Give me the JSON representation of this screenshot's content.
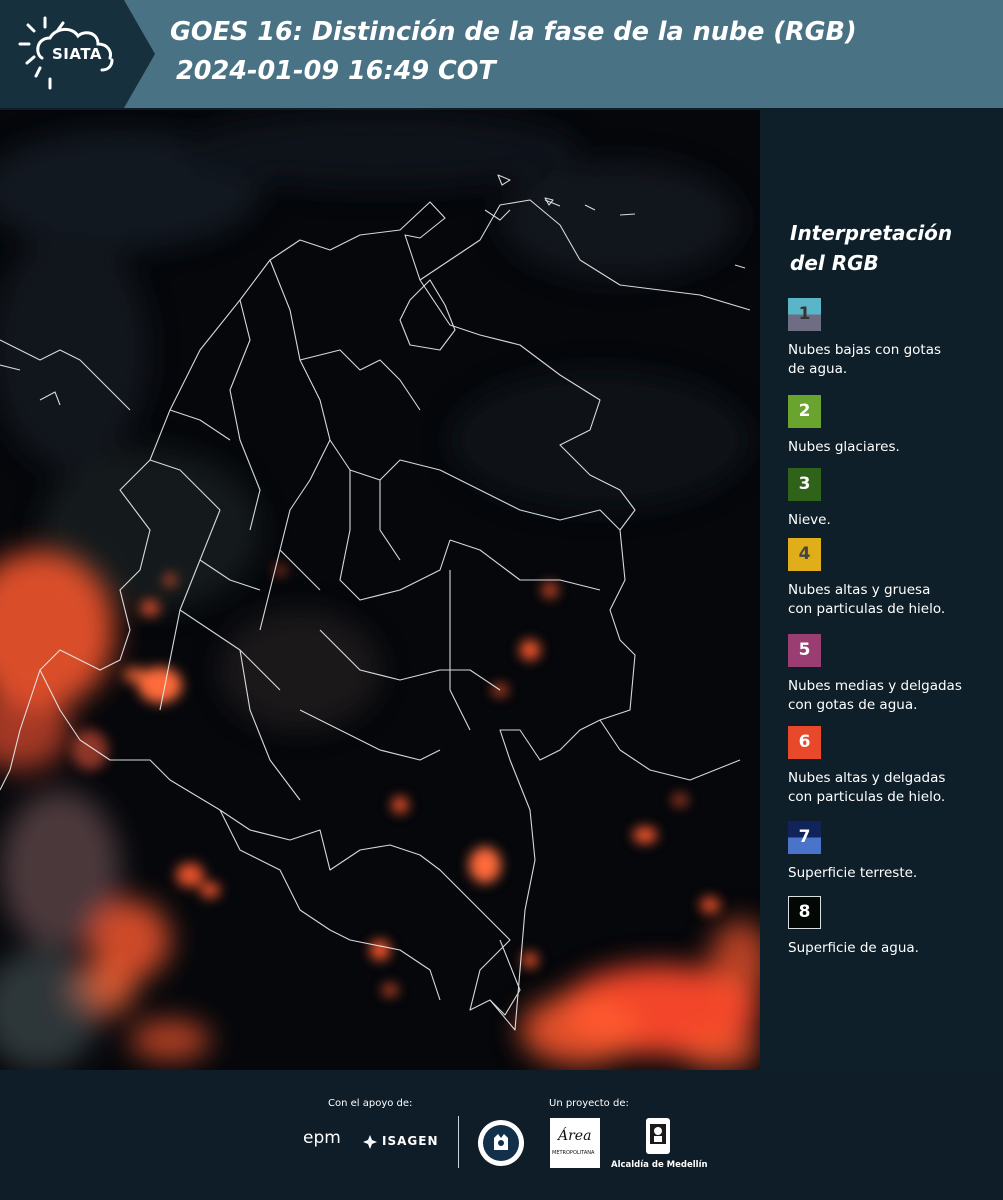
{
  "header": {
    "logo_text": "SIATA",
    "title_line1": "GOES 16: Distinción de la fase de la nube (RGB)",
    "title_line2": "2024-01-09 16:49 COT"
  },
  "legend": {
    "title_line1": "Interpretación",
    "title_line2": "del RGB",
    "items": [
      {
        "number": "1",
        "label_lines": [
          "Nubes bajas con gotas",
          "de agua."
        ],
        "color_top": "#5ab5c8",
        "color_bottom": "#6e6d84",
        "text_color": "#333333"
      },
      {
        "number": "2",
        "label_lines": [
          "Nubes glaciares."
        ],
        "color_top": "#6aa32e",
        "color_bottom": "#6aa32e",
        "text_color": "#ffffff"
      },
      {
        "number": "3",
        "label_lines": [
          "Nieve."
        ],
        "color_top": "#2f6319",
        "color_bottom": "#2f6319",
        "text_color": "#ffffff"
      },
      {
        "number": "4",
        "label_lines": [
          "Nubes altas y gruesa",
          "con particulas de hielo."
        ],
        "color_top": "#e0ae1a",
        "color_bottom": "#e0ae1a",
        "text_color": "#444444"
      },
      {
        "number": "5",
        "label_lines": [
          "Nubes medias y delgadas",
          "con gotas de agua."
        ],
        "color_top": "#9a3d72",
        "color_bottom": "#9a3d72",
        "text_color": "#ffffff"
      },
      {
        "number": "6",
        "label_lines": [
          "Nubes altas y delgadas",
          "con particulas de hielo."
        ],
        "color_top": "#e8492b",
        "color_bottom": "#e8492b",
        "text_color": "#ffffff"
      },
      {
        "number": "7",
        "label_lines": [
          "Superficie terreste."
        ],
        "color_top": "#10235a",
        "color_bottom": "#4a74c9",
        "text_color": "#ffffff"
      },
      {
        "number": "8",
        "label_lines": [
          "Superficie de agua."
        ],
        "color_top": "#030805",
        "color_bottom": "#030805",
        "text_color": "#ffffff"
      }
    ]
  },
  "footer": {
    "support_label": "Con el apoyo de:",
    "project_label": "Un proyecto de:",
    "epm_text": "epm",
    "isagen_text": "ISAGEN",
    "area_text": "Área",
    "area_subtext": "METROPOLITANA",
    "alcaldia_text": "Alcaldía de Medellín"
  },
  "colors": {
    "header_bg": "#4a7285",
    "logo_bg": "#16303e",
    "legend_bg": "#0e1f2a",
    "map_bg": "#05070b",
    "cloud_red": "#ff5a2e"
  }
}
